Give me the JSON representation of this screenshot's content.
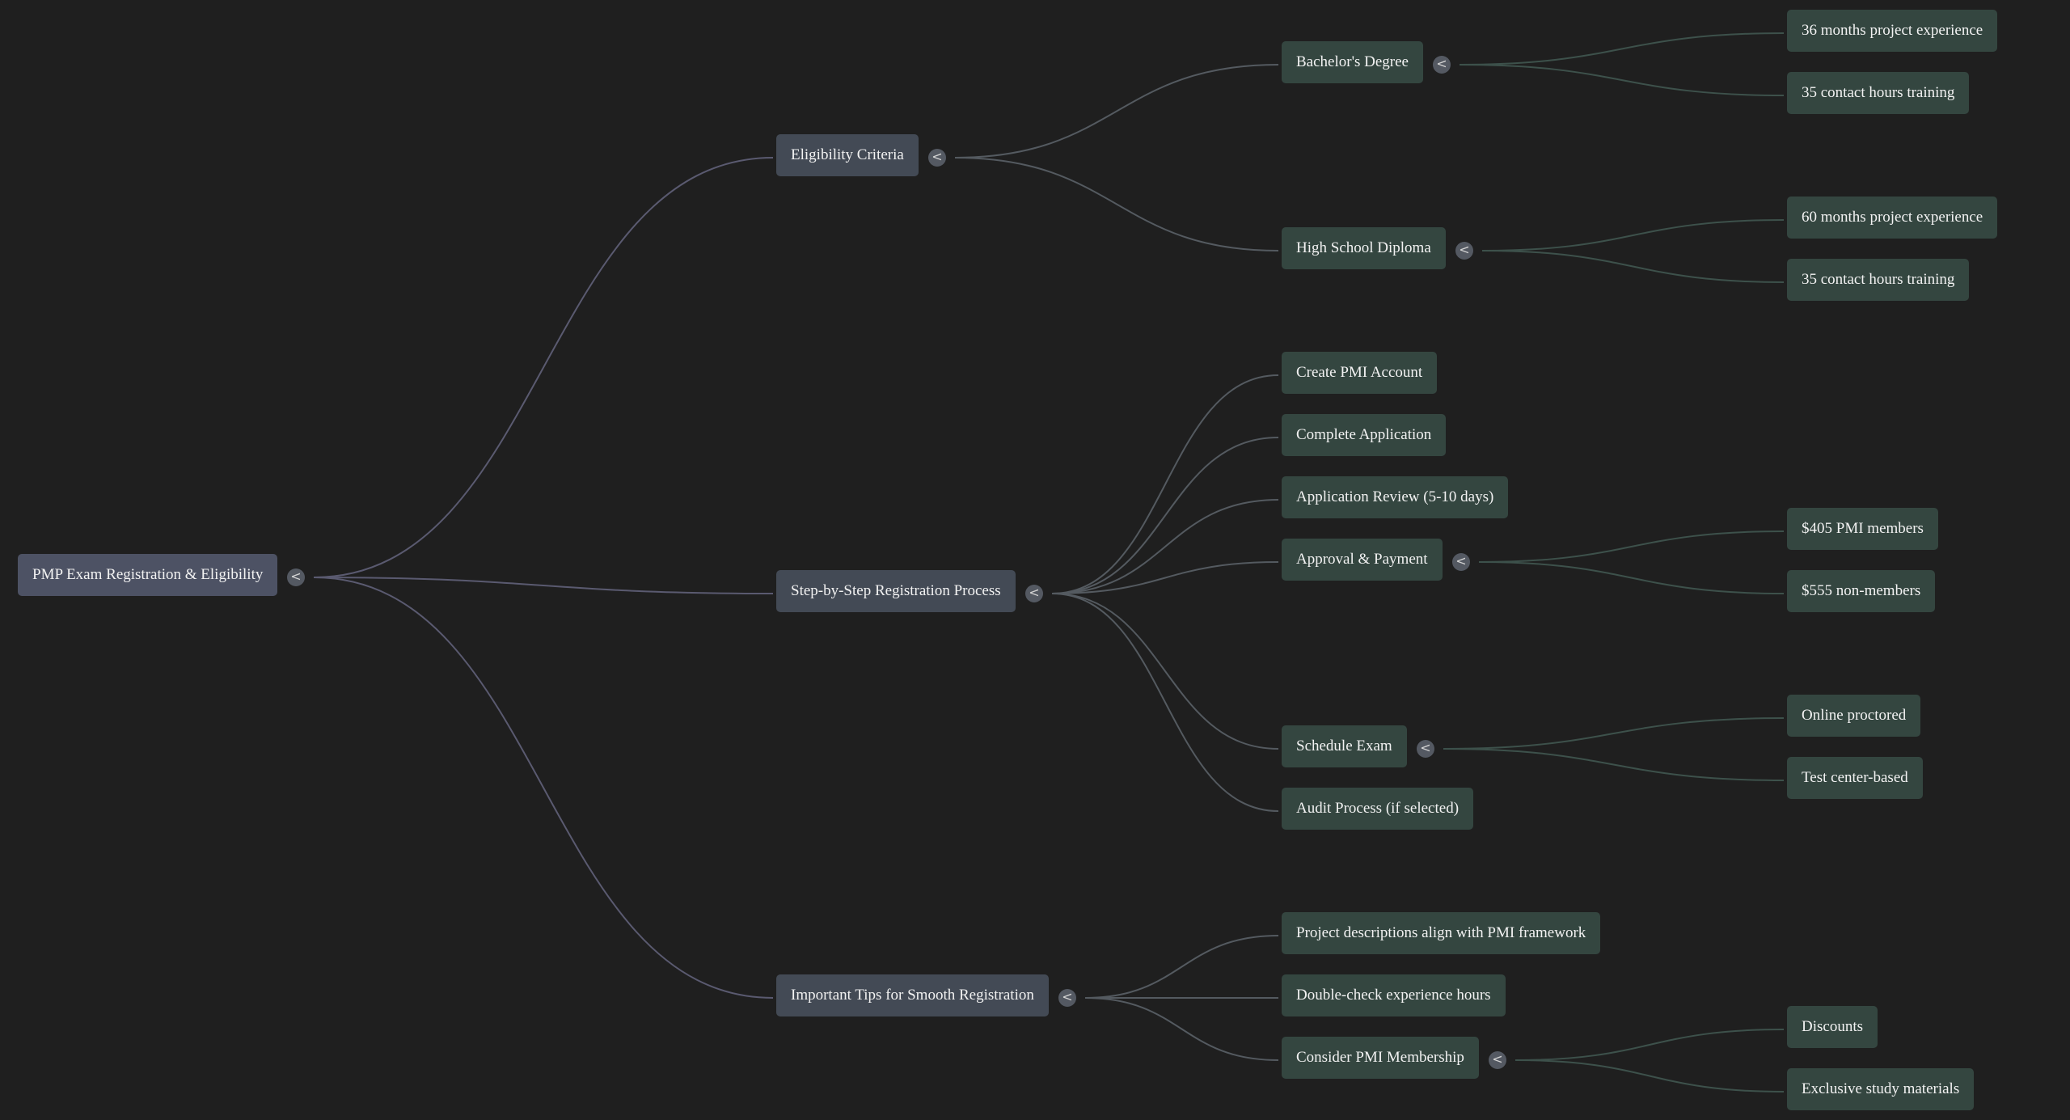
{
  "mindmap": {
    "root": {
      "label": "PMP Exam Registration & Eligibility",
      "toggle": "<",
      "children": [
        {
          "label": "Eligibility Criteria",
          "toggle": "<",
          "children": [
            {
              "label": "Bachelor's Degree",
              "toggle": "<",
              "children": [
                {
                  "label": "36 months project experience"
                },
                {
                  "label": "35 contact hours training"
                }
              ]
            },
            {
              "label": "High School Diploma",
              "toggle": "<",
              "children": [
                {
                  "label": "60 months project experience"
                },
                {
                  "label": "35 contact hours training"
                }
              ]
            }
          ]
        },
        {
          "label": "Step-by-Step Registration Process",
          "toggle": "<",
          "children": [
            {
              "label": "Create PMI Account"
            },
            {
              "label": "Complete Application"
            },
            {
              "label": "Application Review (5-10 days)"
            },
            {
              "label": "Approval & Payment",
              "toggle": "<",
              "children": [
                {
                  "label": "$405 PMI members"
                },
                {
                  "label": "$555 non-members"
                }
              ]
            },
            {
              "label": "Schedule Exam",
              "toggle": "<",
              "children": [
                {
                  "label": "Online proctored"
                },
                {
                  "label": "Test center-based"
                }
              ]
            },
            {
              "label": "Audit Process (if selected)"
            }
          ]
        },
        {
          "label": "Important Tips for Smooth Registration",
          "toggle": "<",
          "children": [
            {
              "label": "Project descriptions align with PMI framework"
            },
            {
              "label": "Double-check experience hours"
            },
            {
              "label": "Consider PMI Membership",
              "toggle": "<",
              "children": [
                {
                  "label": "Discounts"
                },
                {
                  "label": "Exclusive study materials"
                }
              ]
            }
          ]
        }
      ]
    }
  }
}
